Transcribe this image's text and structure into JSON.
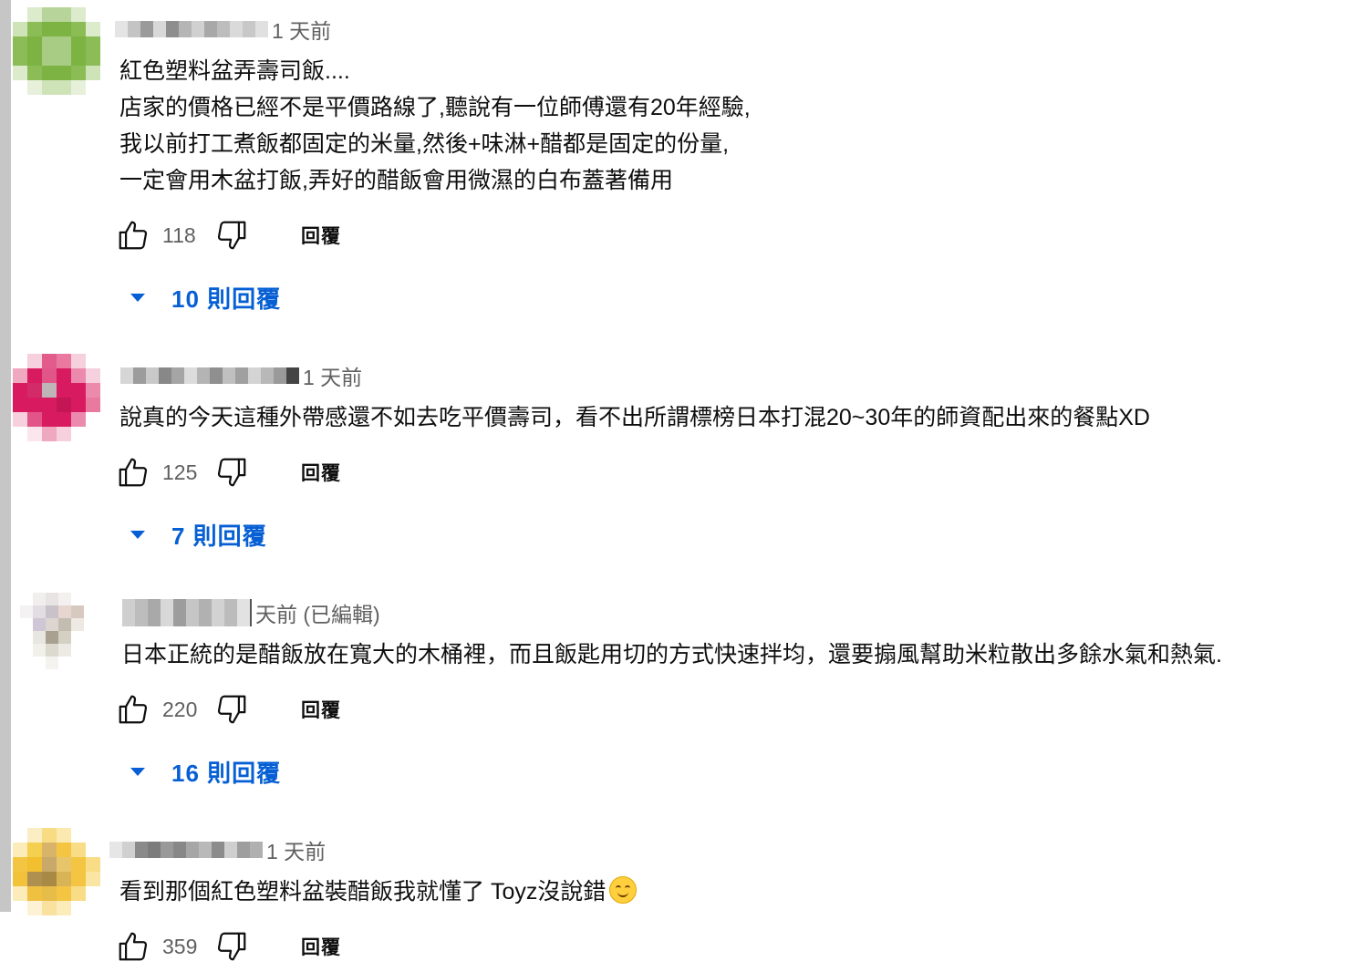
{
  "comments": [
    {
      "time": "1 天前",
      "lines": [
        "紅色塑料盆弄壽司飯....",
        "店家的價格已經不是平價路線了,聽說有一位師傅還有20年經驗,",
        "我以前打工煮飯都固定的米量,然後+味淋+醋都是固定的份量,",
        "一定會用木盆打飯,弄好的醋飯會用微濕的白布蓋著備用"
      ],
      "likes": "118",
      "reply_label": "回覆",
      "replies": "10 則回覆",
      "avatar_color": "#7cb342"
    },
    {
      "time": "1 天前",
      "lines": [
        "說真的今天這種外帶感還不如去吃平價壽司，看不出所謂標榜日本打混20~30年的師資配出來的餐點XD"
      ],
      "likes": "125",
      "reply_label": "回覆",
      "replies": "7 則回覆",
      "avatar_color": "#d81b60"
    },
    {
      "time": "天前 (已編輯)",
      "lines": [
        "日本正統的是醋飯放在寬大的木桶裡，而且飯匙用切的方式快速拌均，還要搧風幫助米粒散出多餘水氣和熱氣."
      ],
      "likes": "220",
      "reply_label": "回覆",
      "replies": "16 則回覆",
      "avatar_color": "#b8b0a8"
    },
    {
      "time": "1 天前",
      "lines": [
        "看到那個紅色塑料盆裝醋飯我就懂了 Toyz沒說錯"
      ],
      "emoji": "smiling-face",
      "likes": "359",
      "reply_label": "回覆",
      "avatar_color": "#f4c542"
    }
  ],
  "colors": {
    "link_blue": "#065fd4",
    "secondary_text": "#606060",
    "primary_text": "#0f0f0f"
  }
}
